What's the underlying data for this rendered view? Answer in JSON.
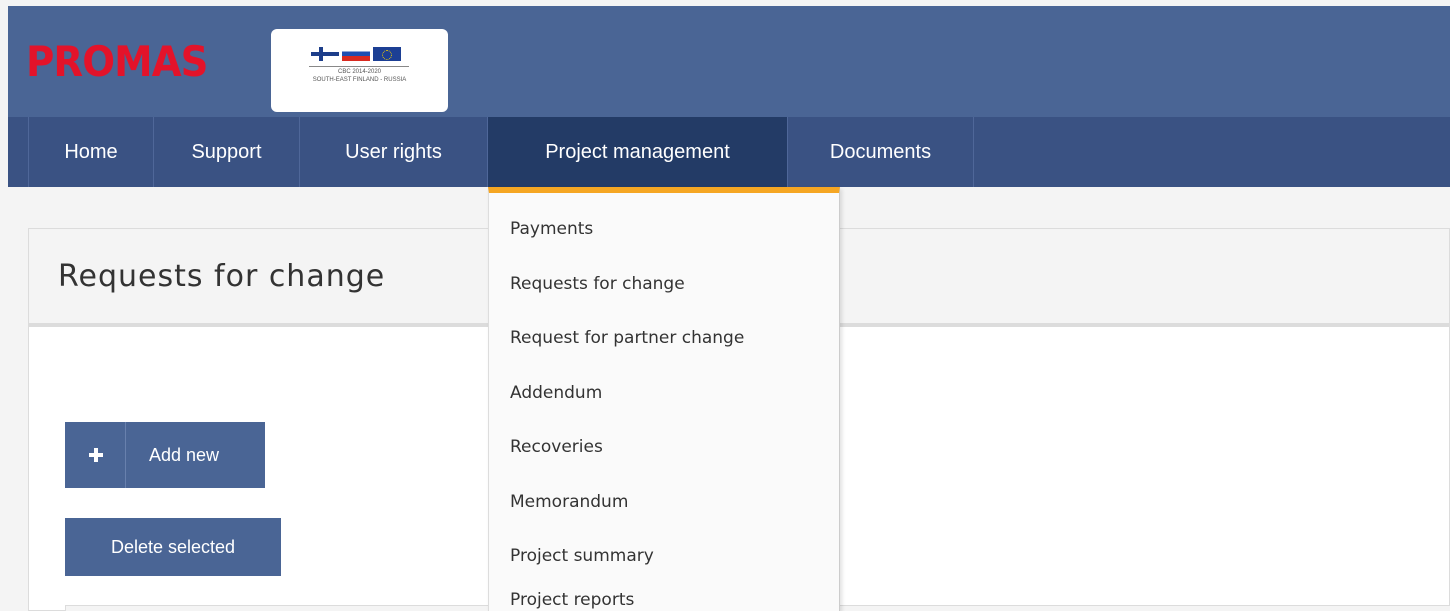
{
  "brand": {
    "name": "PROMAS",
    "badge_line1": "CBC 2014-2020",
    "badge_line2": "SOUTH-EAST FINLAND - RUSSIA"
  },
  "nav": {
    "items": [
      {
        "label": "Home"
      },
      {
        "label": "Support"
      },
      {
        "label": "User rights"
      },
      {
        "label": "Project management"
      },
      {
        "label": "Documents"
      }
    ],
    "active": "Project management"
  },
  "dropdown": {
    "items": [
      {
        "label": "Payments"
      },
      {
        "label": "Requests for change"
      },
      {
        "label": "Request for partner change"
      },
      {
        "label": "Addendum"
      },
      {
        "label": "Recoveries"
      },
      {
        "label": "Memorandum"
      },
      {
        "label": "Project summary"
      },
      {
        "label": "Project reports"
      }
    ]
  },
  "page": {
    "title": "Requests for change",
    "add_new_label": "Add new",
    "delete_selected_label": "Delete selected"
  },
  "colors": {
    "header_bg": "#4a6595",
    "nav_bg": "#3a5283",
    "nav_active_bg": "#233b66",
    "logo_red": "#e3132a",
    "dropdown_accent": "#f5a623",
    "button_bg": "#4a6595"
  }
}
